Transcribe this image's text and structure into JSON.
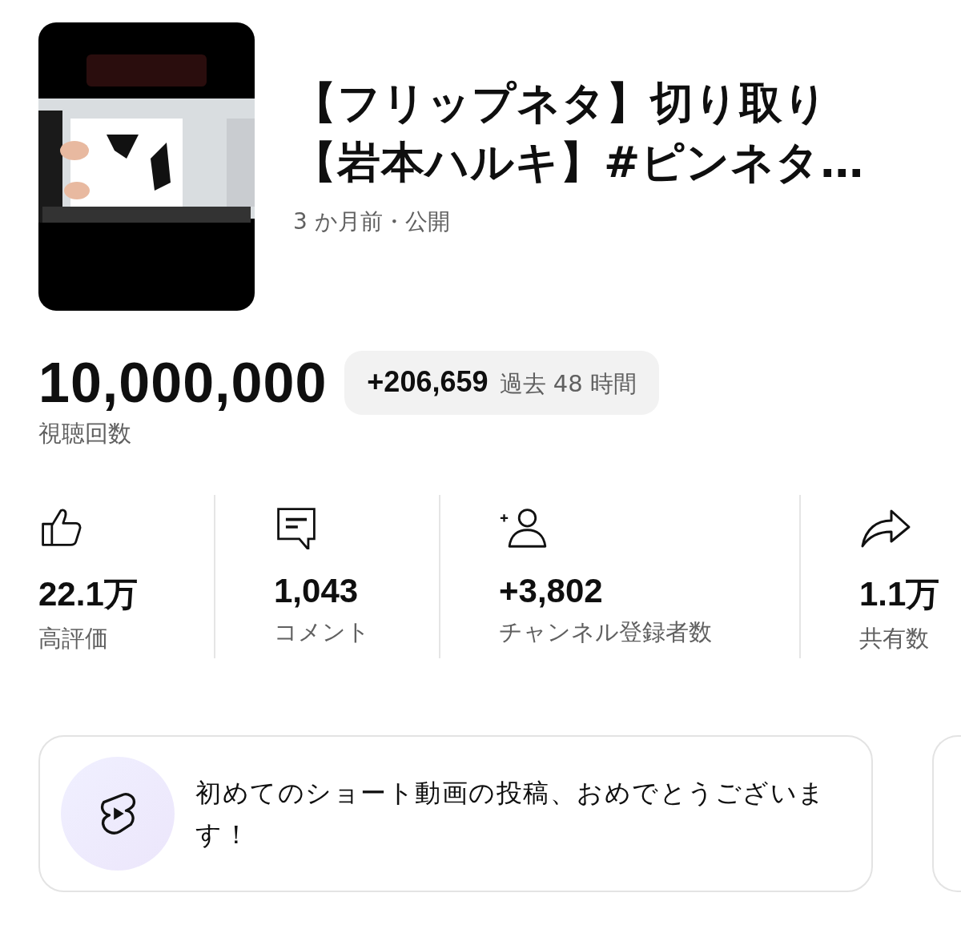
{
  "video": {
    "kind": "picture",
    "title_lines": [
      "【フリップネタ】切り取り",
      "【岩本ハルキ】#ピンネタ…"
    ],
    "meta": "3 か月前・公開"
  },
  "views": {
    "count": "10,000,000",
    "delta": "+206,659",
    "period": "過去 48 時間",
    "label": "視聴回数"
  },
  "stats": [
    {
      "kind": "like",
      "value": "22.1万",
      "label": "高評価"
    },
    {
      "kind": "comment",
      "value": "1,043",
      "label": "コメント"
    },
    {
      "kind": "subscriber",
      "value": "+3,802",
      "label": "チャンネル登録者数"
    },
    {
      "kind": "share",
      "value": "1.1万",
      "label": "共有数"
    }
  ],
  "cards": [
    {
      "kind": "shorts",
      "text": "初めてのショート動画の投稿、おめでとうございます！"
    }
  ]
}
